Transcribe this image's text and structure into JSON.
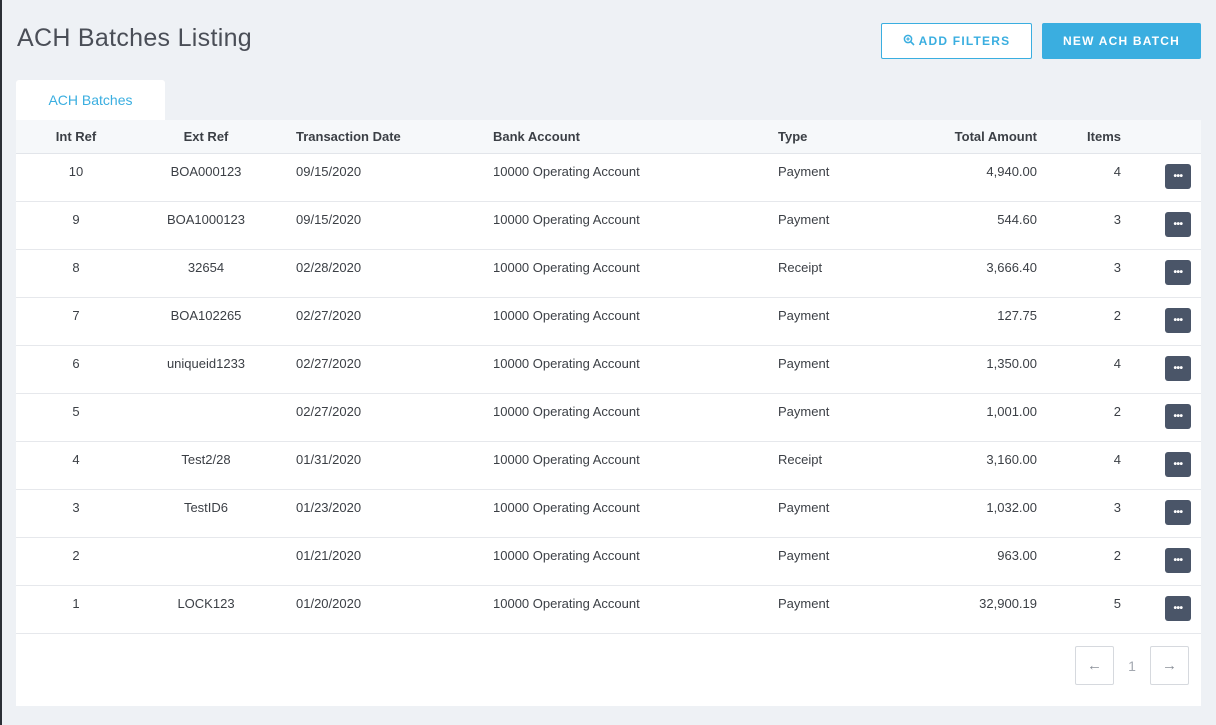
{
  "header": {
    "title": "ACH Batches Listing",
    "filters_label": "ADD FILTERS",
    "filters_icon": "search-plus-icon",
    "new_label": "NEW ACH BATCH",
    "accent_color": "#3aaee0"
  },
  "tabs": [
    {
      "label": "ACH Batches",
      "active": true
    }
  ],
  "table": {
    "columns": {
      "int_ref": "Int Ref",
      "ext_ref": "Ext Ref",
      "date": "Transaction Date",
      "bank": "Bank Account",
      "type": "Type",
      "amount": "Total Amount",
      "items": "Items"
    },
    "rows": [
      {
        "int_ref": "10",
        "ext_ref": "BOA000123",
        "date": "09/15/2020",
        "bank": "10000 Operating Account",
        "type": "Payment",
        "amount": "4,940.00",
        "items": "4",
        "action": "•••"
      },
      {
        "int_ref": "9",
        "ext_ref": "BOA1000123",
        "date": "09/15/2020",
        "bank": "10000 Operating Account",
        "type": "Payment",
        "amount": "544.60",
        "items": "3",
        "action": "•••"
      },
      {
        "int_ref": "8",
        "ext_ref": "32654",
        "date": "02/28/2020",
        "bank": "10000 Operating Account",
        "type": "Receipt",
        "amount": "3,666.40",
        "items": "3",
        "action": "•••"
      },
      {
        "int_ref": "7",
        "ext_ref": "BOA102265",
        "date": "02/27/2020",
        "bank": "10000 Operating Account",
        "type": "Payment",
        "amount": "127.75",
        "items": "2",
        "action": "•••"
      },
      {
        "int_ref": "6",
        "ext_ref": "uniqueid1233",
        "date": "02/27/2020",
        "bank": "10000 Operating Account",
        "type": "Payment",
        "amount": "1,350.00",
        "items": "4",
        "action": "•••"
      },
      {
        "int_ref": "5",
        "ext_ref": "",
        "date": "02/27/2020",
        "bank": "10000 Operating Account",
        "type": "Payment",
        "amount": "1,001.00",
        "items": "2",
        "action": "•••"
      },
      {
        "int_ref": "4",
        "ext_ref": "Test2/28",
        "date": "01/31/2020",
        "bank": "10000 Operating Account",
        "type": "Receipt",
        "amount": "3,160.00",
        "items": "4",
        "action": "•••"
      },
      {
        "int_ref": "3",
        "ext_ref": "TestID6",
        "date": "01/23/2020",
        "bank": "10000 Operating Account",
        "type": "Payment",
        "amount": "1,032.00",
        "items": "3",
        "action": "•••"
      },
      {
        "int_ref": "2",
        "ext_ref": "",
        "date": "01/21/2020",
        "bank": "10000 Operating Account",
        "type": "Payment",
        "amount": "963.00",
        "items": "2",
        "action": "•••"
      },
      {
        "int_ref": "1",
        "ext_ref": "LOCK123",
        "date": "01/20/2020",
        "bank": "10000 Operating Account",
        "type": "Payment",
        "amount": "32,900.19",
        "items": "5",
        "action": "•••"
      }
    ]
  },
  "pagination": {
    "prev_icon": "arrow-left-icon",
    "prev_glyph": "←",
    "current_page": "1",
    "next_icon": "arrow-right-icon",
    "next_glyph": "→"
  }
}
